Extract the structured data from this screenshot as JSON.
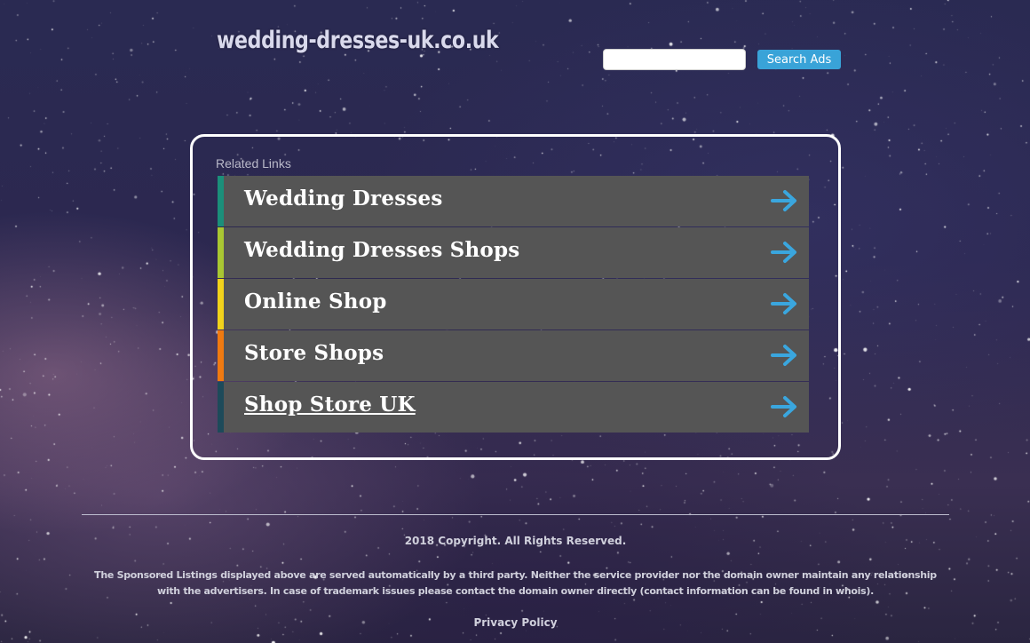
{
  "header": {
    "site_title": "wedding-dresses-uk.co.uk",
    "search_placeholder": "",
    "search_button_label": "Search Ads"
  },
  "related": {
    "label": "Related Links",
    "links": [
      {
        "label": "Wedding Dresses",
        "bar_color": "#1b8f7a"
      },
      {
        "label": "Wedding Dresses Shops",
        "bar_color": "#a9c732"
      },
      {
        "label": "Online Shop",
        "bar_color": "#f2d31b"
      },
      {
        "label": "Store Shops",
        "bar_color": "#f07a10"
      },
      {
        "label": "Shop Store UK",
        "bar_color": "#1d4a5a"
      }
    ],
    "arrow_color": "#3aa6de",
    "arrow_icon": "arrow-right-icon"
  },
  "footer": {
    "copyright": "2018 Copyright. All Rights Reserved.",
    "disclaimer": "The Sponsored Listings displayed above are served automatically by a third party. Neither the service provider nor the domain owner maintain any relationship with the advertisers. In case of trademark issues please contact the domain owner directly (contact information can be found in whois).",
    "privacy_label": "Privacy Policy"
  }
}
